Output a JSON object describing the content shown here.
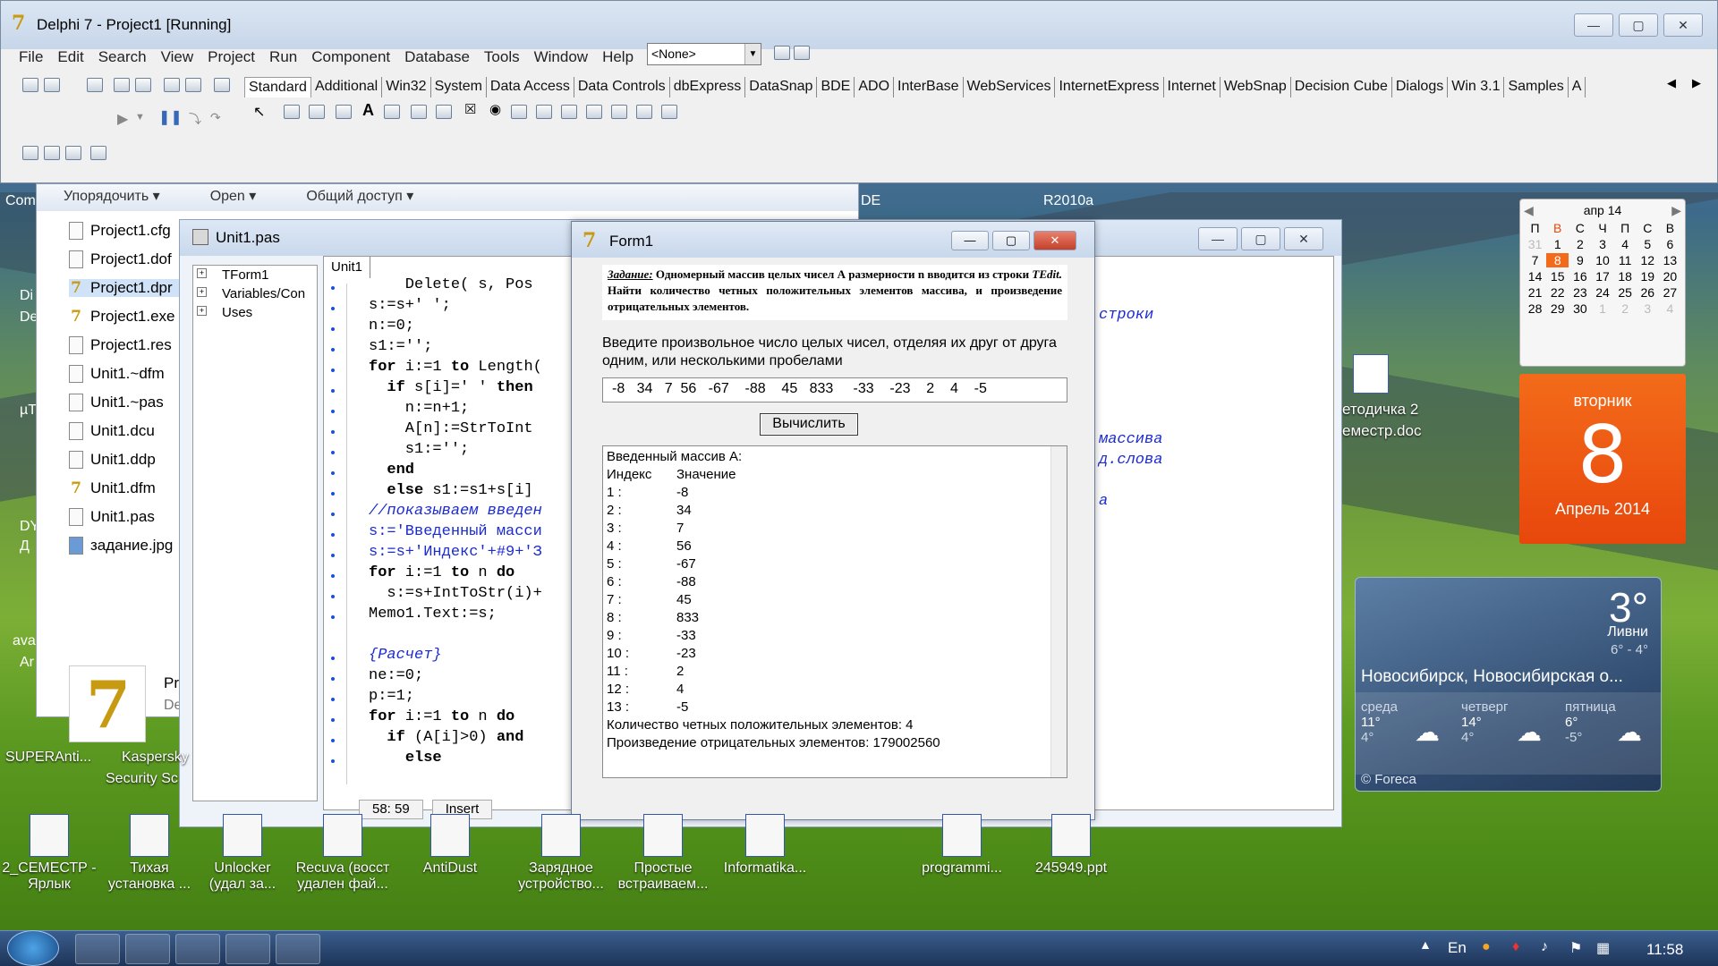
{
  "delphi": {
    "title": "Delphi 7 - Project1 [Running]",
    "menu": [
      "File",
      "Edit",
      "Search",
      "View",
      "Project",
      "Run",
      "Component",
      "Database",
      "Tools",
      "Window",
      "Help"
    ],
    "combo_value": "<None>",
    "palette_tabs": [
      "Standard",
      "Additional",
      "Win32",
      "System",
      "Data Access",
      "Data Controls",
      "dbExpress",
      "DataSnap",
      "BDE",
      "ADO",
      "InterBase",
      "WebServices",
      "InternetExpress",
      "Internet",
      "WebSnap",
      "Decision Cube",
      "Dialogs",
      "Win 3.1",
      "Samples",
      "A"
    ]
  },
  "explorer": {
    "toolbar": [
      "Упорядочить ▾",
      "Open ▾",
      "Общий доступ ▾"
    ],
    "files": [
      "Project1.cfg",
      "Project1.dof",
      "Project1.dpr",
      "Project1.exe",
      "Project1.res",
      "Unit1.~dfm",
      "Unit1.~pas",
      "Unit1.dcu",
      "Unit1.ddp",
      "Unit1.dfm",
      "Unit1.pas",
      "задание.jpg"
    ],
    "detail_name": "Pr",
    "detail_sub": "De"
  },
  "editor": {
    "title": "Unit1.pas",
    "tree": [
      "TForm1",
      "Variables/Con",
      "Uses"
    ],
    "tab": "Unit1",
    "lines": [
      {
        "t": "    Delete( s, Pos",
        "k": ""
      },
      {
        "t": "s:=s+' ';",
        "k": ""
      },
      {
        "t": "n:=0;",
        "k": ""
      },
      {
        "t": "s1:='';",
        "k": ""
      },
      {
        "t": "for i:=1 to Length(",
        "k": "for"
      },
      {
        "t": "  if s[i]=' ' then",
        "k": "if"
      },
      {
        "t": "    n:=n+1;",
        "k": ""
      },
      {
        "t": "    A[n]:=StrToInt",
        "k": ""
      },
      {
        "t": "    s1:='';",
        "k": ""
      },
      {
        "t": "  end",
        "k": "end"
      },
      {
        "t": "  else s1:=s1+s[i]",
        "k": "else"
      },
      {
        "t": "//показываем введен",
        "k": "cm"
      },
      {
        "t": "s:='Введенный масси",
        "k": "st"
      },
      {
        "t": "s:=s+'Индекс'+#9+'З",
        "k": "st"
      },
      {
        "t": "for i:=1 to n do",
        "k": "for"
      },
      {
        "t": "  s:=s+IntToStr(i)+",
        "k": ""
      },
      {
        "t": "Memo1.Text:=s;",
        "k": ""
      },
      {
        "t": "",
        "k": ""
      },
      {
        "t": "{Расчет}",
        "k": "cm"
      },
      {
        "t": "ne:=0;",
        "k": ""
      },
      {
        "t": "p:=1;",
        "k": ""
      },
      {
        "t": "for i:=1 to n do",
        "k": "for"
      },
      {
        "t": "  if (A[i]>0) and",
        "k": "if"
      },
      {
        "t": "    else",
        "k": "else"
      }
    ],
    "right_fragments": [
      "строки",
      "массива",
      "д.слова",
      "а"
    ],
    "status_pos": "58: 59",
    "status_mode": "Insert"
  },
  "form1": {
    "title": "Form1",
    "task_label": "Задание:",
    "task_text": "Одномерный массив целых чисел А размерности n вводится из строки",
    "task_tedit": "TEdit.",
    "task_rest": "Найти количество четных положительных элементов массива, и произведение отрицательных элементов.",
    "prompt": "Введите произвольное число целых чисел, отделяя их друг от друга одним, или несколькими пробелами",
    "input_value": "-8   34   7  56   -67    -88    45   833     -33    -23    2    4    -5",
    "button": "Вычислить",
    "memo_header": "Введенный массив А:",
    "memo_cols": [
      "Индекс",
      "Значение"
    ],
    "memo_rows": [
      [
        "1 :",
        "-8"
      ],
      [
        "2 :",
        "34"
      ],
      [
        "3 :",
        "7"
      ],
      [
        "4 :",
        "56"
      ],
      [
        "5 :",
        "-67"
      ],
      [
        "6 :",
        "-88"
      ],
      [
        "7 :",
        "45"
      ],
      [
        "8 :",
        "833"
      ],
      [
        "9 :",
        "-33"
      ],
      [
        "10 :",
        "-23"
      ],
      [
        "11 :",
        "2"
      ],
      [
        "12 :",
        "4"
      ],
      [
        "13 :",
        "-5"
      ]
    ],
    "result_count": "Количество четных положительных элементов: 4",
    "result_product": "Произведение отрицательных элементов: 179002560"
  },
  "desktop": {
    "bg_texts": [
      "Com",
      "DE",
      "R2010a",
      "Di",
      "De",
      "µT",
      "DY",
      "Д",
      "ava",
      "Ar"
    ],
    "calendar": {
      "month": "апр 14",
      "weekdays": [
        "П",
        "В",
        "С",
        "Ч",
        "П",
        "С",
        "В"
      ],
      "days": [
        "31",
        "1",
        "2",
        "3",
        "4",
        "5",
        "6",
        "7",
        "8",
        "9",
        "10",
        "11",
        "12",
        "13",
        "14",
        "15",
        "16",
        "17",
        "18",
        "19",
        "20",
        "21",
        "22",
        "23",
        "24",
        "25",
        "26",
        "27",
        "28",
        "29",
        "30",
        "1",
        "2",
        "3",
        "4"
      ]
    },
    "big_date": {
      "weekday": "вторник",
      "day": "8",
      "month_year": "Апрель 2014"
    },
    "weather": {
      "temp": "3°",
      "cond": "Ливни",
      "range": "6° - 4°",
      "city": "Новосибирск, Новосибирская о...",
      "days": [
        {
          "name": "среда",
          "hi": "11°",
          "lo": "4°"
        },
        {
          "name": "четверг",
          "hi": "14°",
          "lo": "4°"
        },
        {
          "name": "пятница",
          "hi": "6°",
          "lo": "-5°"
        }
      ],
      "brand": "© Foreca"
    },
    "doc_icon_label": [
      "етодичка 2",
      "еместр.doc"
    ],
    "icons": [
      {
        "l1": "2_СЕМЕСТР -",
        "l2": "Ярлык"
      },
      {
        "l1": "Тихая",
        "l2": "установка ..."
      },
      {
        "l1": "Unlocker",
        "l2": "(удал за..."
      },
      {
        "l1": "Recuva (восст",
        "l2": "удален фай..."
      },
      {
        "l1": "AntiDust",
        "l2": ""
      },
      {
        "l1": "Зарядное",
        "l2": "устройство..."
      },
      {
        "l1": "Простые",
        "l2": "встраиваем..."
      },
      {
        "l1": "Informatika...",
        "l2": ""
      },
      {
        "l1": "programmi...",
        "l2": ""
      },
      {
        "l1": "245949.ppt",
        "l2": ""
      }
    ],
    "left_icons": [
      "SUPERAnti...",
      "Kaspersky",
      "Security Sc"
    ]
  },
  "taskbar": {
    "lang": "En",
    "time": "11:58"
  }
}
